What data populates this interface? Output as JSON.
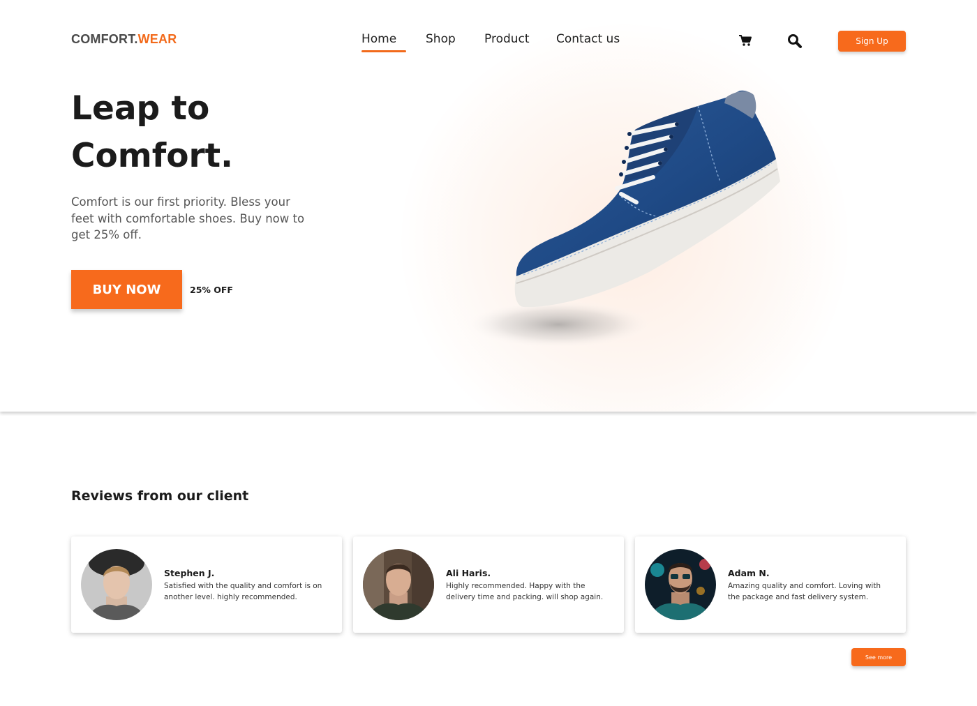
{
  "brand": {
    "part1": "COMFORT.",
    "part2": "WEAR",
    "accent": "#f26a1b"
  },
  "nav": {
    "items": [
      "Home",
      "Shop",
      "Product",
      "Contact us"
    ],
    "active": "Home"
  },
  "header": {
    "cart_icon": "cart-icon",
    "search_icon": "search-icon",
    "signup_label": "Sign Up"
  },
  "hero": {
    "headline_line1": "Leap to",
    "headline_line2": "Comfort.",
    "description": "Comfort is our first priority. Bless your feet with comfortable shoes. Buy now to get 25% off.",
    "cta_label": "BUY NOW",
    "discount_label": "25% OFF",
    "product_image": "blue-suede-sneaker"
  },
  "reviews": {
    "title": "Reviews from our client",
    "items": [
      {
        "name": "Stephen J.",
        "text": "Satisfied with the quality and comfort is on another level. highly recommended."
      },
      {
        "name": "Ali Haris.",
        "text": "Highly recommended. Happy with the delivery time and packing. will shop again."
      },
      {
        "name": "Adam N.",
        "text": "Amazing quality and comfort. Loving with the package and fast delivery system."
      }
    ],
    "see_more_label": "See more"
  }
}
